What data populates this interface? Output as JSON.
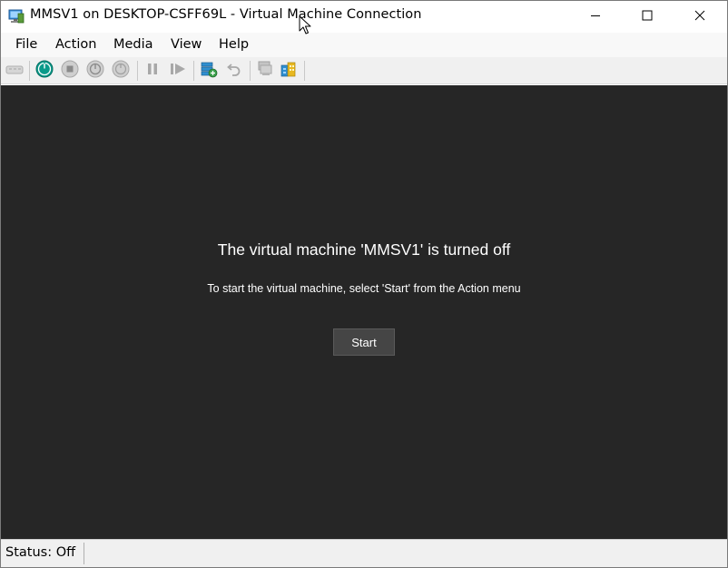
{
  "window": {
    "title": "MMSV1 on DESKTOP-CSFF69L - Virtual Machine Connection",
    "icon": "hyper-v-vm-icon",
    "controls": [
      "minimize-icon",
      "maximize-icon",
      "close-icon"
    ]
  },
  "menu": {
    "items": [
      {
        "label": "File"
      },
      {
        "label": "Action"
      },
      {
        "label": "Media"
      },
      {
        "label": "View"
      },
      {
        "label": "Help"
      }
    ]
  },
  "toolbar": {
    "buttons": [
      {
        "icon": "ctrl-alt-del-icon",
        "enabled": false
      },
      {
        "icon": "start-icon",
        "enabled": true
      },
      {
        "icon": "turn-off-icon",
        "enabled": false
      },
      {
        "icon": "shut-down-icon",
        "enabled": false
      },
      {
        "icon": "save-icon",
        "enabled": false
      },
      {
        "icon": "pause-icon",
        "enabled": false
      },
      {
        "icon": "resume-icon",
        "enabled": false
      },
      {
        "icon": "checkpoint-icon",
        "enabled": true
      },
      {
        "icon": "revert-icon",
        "enabled": false
      },
      {
        "icon": "enhanced-session-icon",
        "enabled": false
      },
      {
        "icon": "share-icon",
        "enabled": true
      }
    ]
  },
  "vm_display": {
    "heading": "The virtual machine 'MMSV1' is turned off",
    "instruction": "To start the virtual machine, select 'Start' from the Action menu",
    "start_label": "Start"
  },
  "status": {
    "text": "Status: Off"
  },
  "colors": {
    "vm_background": "#262626",
    "start_button": "#454545",
    "start_icon_accent": "#0a9a8a"
  }
}
